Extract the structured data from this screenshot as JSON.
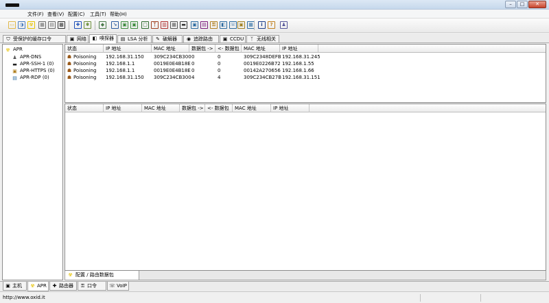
{
  "window": {
    "minimize": "–",
    "maximize": "□",
    "close": "✕"
  },
  "menu": [
    {
      "label": "文件(F)"
    },
    {
      "label": "查看(V)"
    },
    {
      "label": "配置(C)"
    },
    {
      "label": "工具(T)"
    },
    {
      "label": "帮助(H)"
    }
  ],
  "toolbar_icons": [
    {
      "name": "open-folder-icon",
      "glyph": "▭",
      "color": "#e0b84a"
    },
    {
      "name": "sniffer-icon",
      "glyph": "◑",
      "color": "#4b7dbf"
    },
    {
      "name": "apr-icon",
      "glyph": "☢",
      "color": "#e6c200"
    },
    {
      "name": "network-icon",
      "glyph": "▦",
      "color": "#6a6a6a"
    },
    {
      "name": "scan-icon",
      "glyph": "▤",
      "color": "#6a6a6a"
    },
    {
      "name": "qr-icon",
      "glyph": "▩",
      "color": "#333333"
    },
    {
      "name": "add-icon",
      "glyph": "✚",
      "color": "#1d4fb8"
    },
    {
      "name": "settings-icon",
      "glyph": "✱",
      "color": "#6c8f3a"
    },
    {
      "name": "certificate-icon",
      "glyph": "◆",
      "color": "#4a7a4a"
    },
    {
      "name": "route-icon",
      "glyph": "↘",
      "color": "#2a5aa0"
    },
    {
      "name": "lsa-icon",
      "glyph": "▣",
      "color": "#3a8a3a"
    },
    {
      "name": "hash-icon",
      "glyph": "▣",
      "color": "#3a8a3a"
    },
    {
      "name": "monitor-icon",
      "glyph": "▢",
      "color": "#2f6b2f"
    },
    {
      "name": "wireless-icon",
      "glyph": "ᛉ",
      "color": "#a04020"
    },
    {
      "name": "chart-icon",
      "glyph": "▥",
      "color": "#b03030"
    },
    {
      "name": "grid-icon",
      "glyph": "▦",
      "color": "#555555"
    },
    {
      "name": "display-icon",
      "glyph": "▬",
      "color": "#333333"
    },
    {
      "name": "device-icon",
      "glyph": "▣",
      "color": "#2a6aa0"
    },
    {
      "name": "cisco-icon",
      "glyph": "▤",
      "color": "#7a1a7a"
    },
    {
      "name": "key-icon",
      "glyph": "⚿",
      "color": "#b08020"
    },
    {
      "name": "decode-icon",
      "glyph": "◧",
      "color": "#2a6aa0"
    },
    {
      "name": "voip-icon",
      "glyph": "☏",
      "color": "#2a6aa0"
    },
    {
      "name": "lock-icon",
      "glyph": "▣",
      "color": "#a08020"
    },
    {
      "name": "calculator-icon",
      "glyph": "▦",
      "color": "#2a6aa0"
    },
    {
      "name": "info-icon",
      "glyph": "i",
      "color": "#1d3f8a"
    },
    {
      "name": "help-icon",
      "glyph": "?",
      "color": "#c08020"
    },
    {
      "name": "user-icon",
      "glyph": "♟",
      "color": "#555599"
    }
  ],
  "top_tabs": [
    {
      "label": "受保护的缓存口令",
      "icon": "⛉"
    },
    {
      "label": "网络",
      "icon": "▣"
    },
    {
      "label": "嗅探器",
      "icon": "◧"
    },
    {
      "label": "LSA 分析",
      "icon": "▤"
    },
    {
      "label": "破解器",
      "icon": "✎"
    },
    {
      "label": "追踪路由",
      "icon": "◉"
    },
    {
      "label": "CCDU",
      "icon": "▣"
    },
    {
      "label": "无线相关",
      "icon": "ᛉ"
    }
  ],
  "tree": {
    "root": {
      "label": "APR"
    },
    "children": [
      {
        "label": "APR-DNS"
      },
      {
        "label": "APR-SSH-1 (0)"
      },
      {
        "label": "APR-HTTPS (0)"
      },
      {
        "label": "APR-RDP (0)"
      }
    ]
  },
  "top_table": {
    "headers": [
      "状态",
      "IP 地址",
      "MAC 地址",
      "数据包 ->",
      "<- 数据包",
      "MAC 地址",
      "IP 地址"
    ],
    "rows": [
      [
        "Poisoning",
        "192.168.31.150",
        "309C234CB300",
        "0",
        "0",
        "309C2348DEFB",
        "192.168.31.245"
      ],
      [
        "Poisoning",
        "192.168.1.1",
        "0019E0E4B18E",
        "0",
        "0",
        "0019E0226B72",
        "192.168.1.55"
      ],
      [
        "Poisoning",
        "192.168.1.1",
        "0019E0E4B18E",
        "0",
        "0",
        "00142A270656",
        "192.168.1.66"
      ],
      [
        "Poisoning",
        "192.168.31.150",
        "309C234CB300",
        "4",
        "4",
        "309C234CB27B",
        "192.168.31.151"
      ]
    ]
  },
  "bottom_table": {
    "headers": [
      "状态",
      "IP 地址",
      "MAC 地址",
      "数据包 ->",
      "<- 数据包",
      "MAC 地址",
      "IP 地址"
    ]
  },
  "inner_tab": {
    "label": "配置 / 路由数据包"
  },
  "bottom_tabs": [
    {
      "label": "主机",
      "icon": "▣"
    },
    {
      "label": "APR",
      "icon": "☢"
    },
    {
      "label": "路由器",
      "icon": "✚"
    },
    {
      "label": "口令",
      "icon": "⚿"
    },
    {
      "label": "VoIP",
      "icon": "☏"
    }
  ],
  "status": {
    "url": "http://www.oxid.it"
  },
  "colors": {
    "apr_yellow": "#e6c200",
    "poison_brown": "#9a5b1c"
  }
}
